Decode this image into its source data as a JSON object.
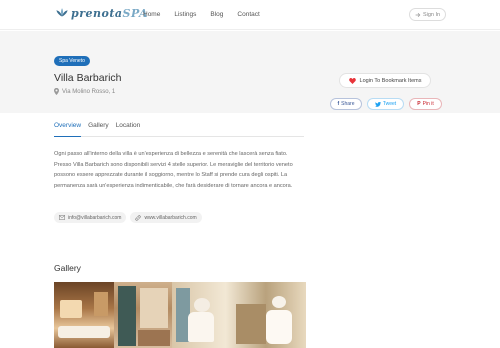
{
  "header": {
    "logo_main": "prenota",
    "logo_accent": "SPA",
    "nav": [
      "Home",
      "Listings",
      "Blog",
      "Contact"
    ],
    "signin": "Sign In"
  },
  "listing": {
    "category": "Spa Veneto",
    "title": "Villa Barbarich",
    "address": "Via Molino Rosso, 1",
    "bookmark": "Login To Bookmark Items",
    "share": [
      "Share",
      "Tweet",
      "Pin it"
    ]
  },
  "tabs": [
    "Overview",
    "Gallery",
    "Location"
  ],
  "description": "Ogni passo all'interno della villa è un'esperienza di bellezza e serenità che lascerà senza fiato. Presso Villa Barbarich sono disponibili servizi 4 stelle superior. Le meraviglie del territorio veneto possono essere apprezzate durante il soggiorno, mentre lo Staff si prende cura degli ospiti. La permanenza sarà un'esperienza indimenticabile, che farà desiderare di tornare ancora e ancora.",
  "contacts": {
    "email": "info@villabarbarich.com",
    "website": "www.villabarbarich.com"
  },
  "gallery_title": "Gallery",
  "colors": {
    "accent": "#1f6fb9",
    "heart": "#e8343a"
  }
}
